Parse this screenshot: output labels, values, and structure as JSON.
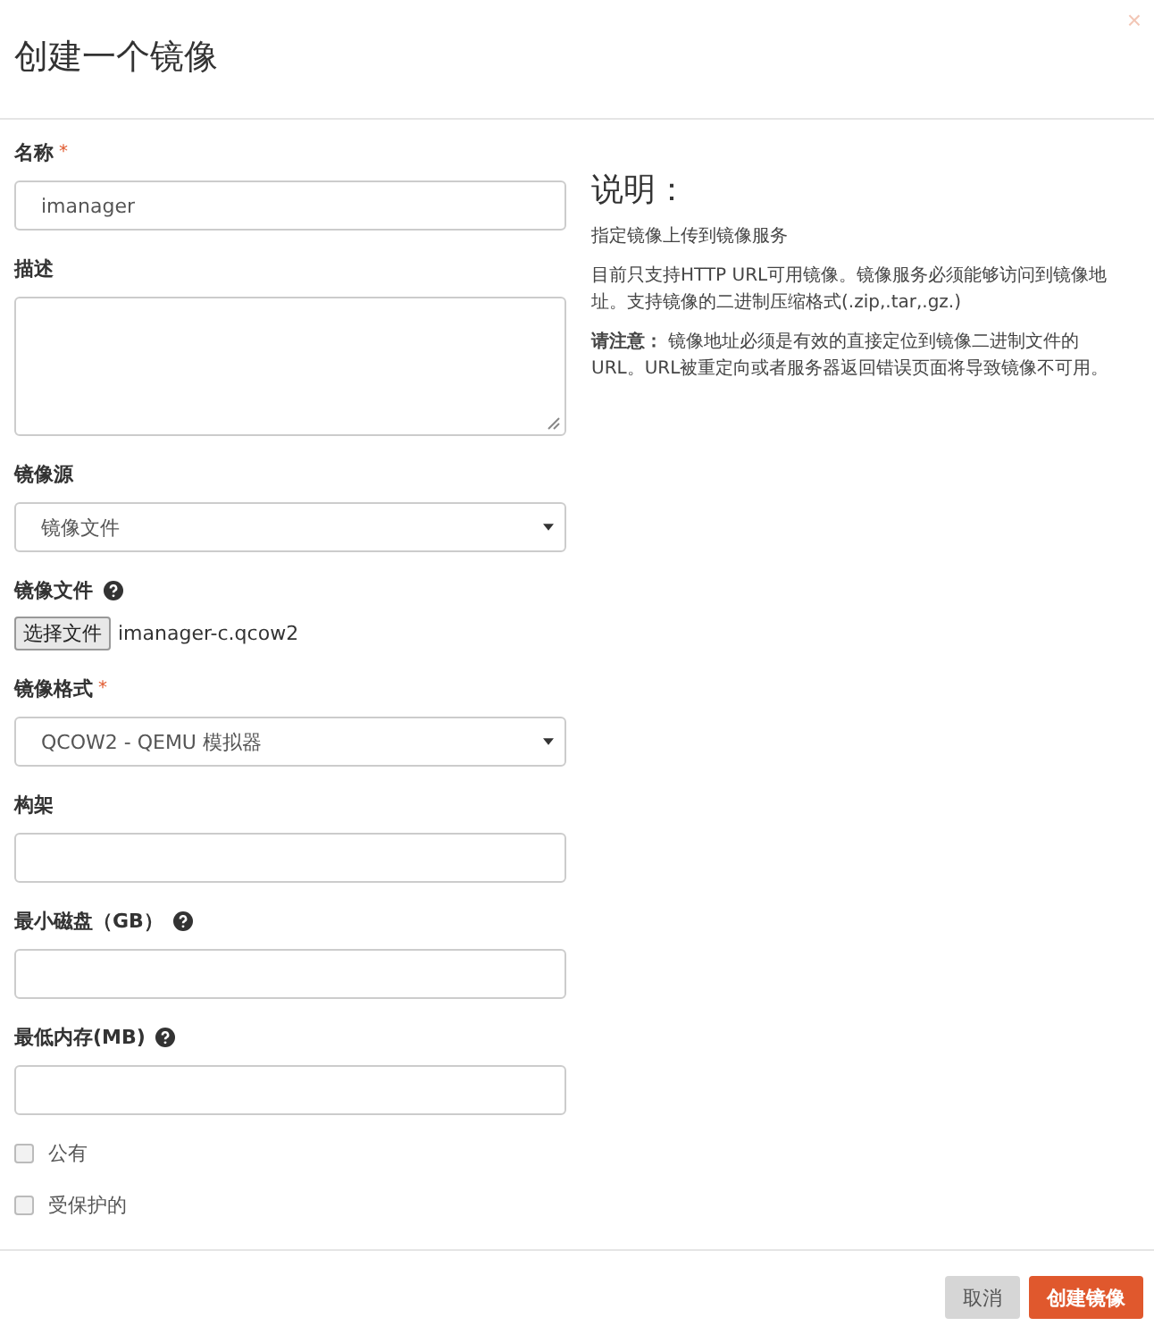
{
  "dialog": {
    "title": "创建一个镜像",
    "close": "×"
  },
  "fields": [
    {
      "kind": "text",
      "label": "名称",
      "required_mark": "*",
      "help": false,
      "value": "imanager"
    },
    {
      "kind": "textarea",
      "label": "描述",
      "help": false
    },
    {
      "kind": "select",
      "label": "镜像源",
      "help": false,
      "value": "镜像文件"
    },
    {
      "kind": "file",
      "label": "镜像文件",
      "help": true,
      "button": "选择文件",
      "filename": "imanager-c.qcow2"
    },
    {
      "kind": "select",
      "label": "镜像格式",
      "required_mark": "*",
      "help": false,
      "value": "QCOW2 - QEMU 模拟器"
    },
    {
      "kind": "text",
      "label": "构架",
      "help": false
    },
    {
      "kind": "text",
      "label": "最小磁盘（GB）",
      "help": true
    },
    {
      "kind": "text",
      "label": "最低内存(MB)",
      "help": true
    },
    {
      "kind": "checkbox",
      "label": "公有",
      "checked": false
    },
    {
      "kind": "checkbox",
      "label": "受保护的",
      "checked": false
    }
  ],
  "help_panel": {
    "heading": "说明：",
    "paragraphs": [
      "指定镜像上传到镜像服务",
      "目前只支持HTTP URL可用镜像。镜像服务必须能够访问到镜像地址。支持镜像的二进制压缩格式(.zip,.tar,.gz.)",
      "**请注意：** 镜像地址必须是有效的直接定位到镜像二进制文件的URL。URL被重定向或者服务器返回错误页面将导致镜像不可用。"
    ]
  },
  "buttons": [
    {
      "kind": "cancel",
      "label": "取消"
    },
    {
      "kind": "primary",
      "label": "创建镜像"
    }
  ]
}
